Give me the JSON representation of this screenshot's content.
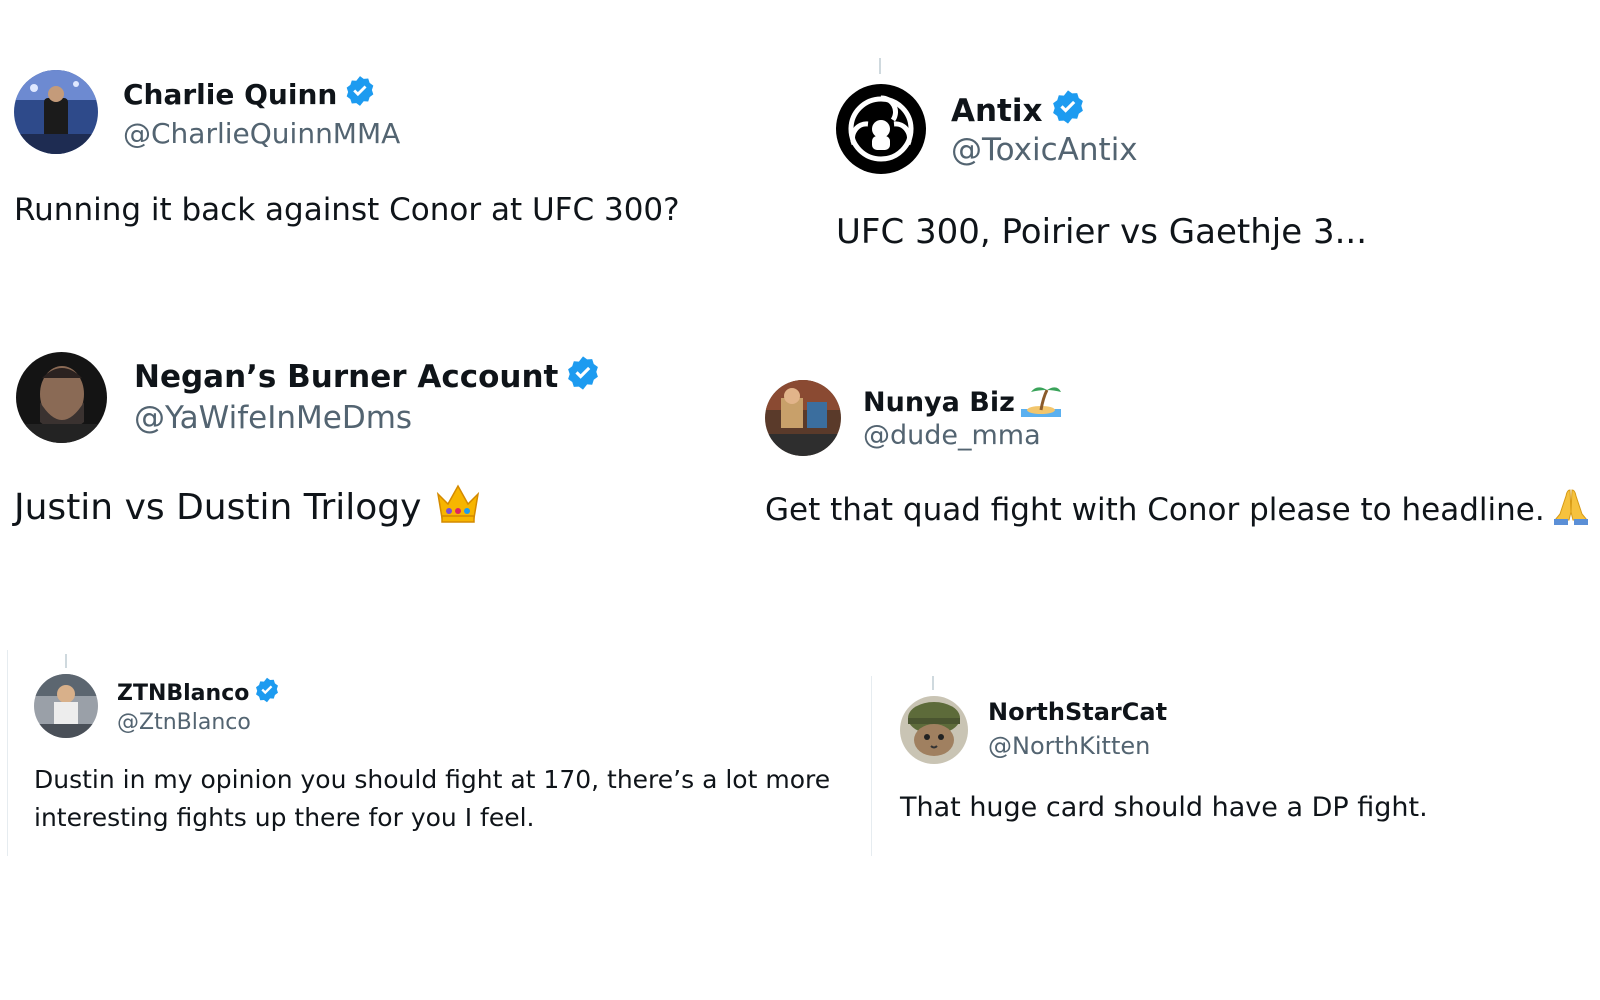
{
  "tweets": [
    {
      "name": "Charlie Quinn",
      "handle": "@CharlieQuinnMMA",
      "text": "Running it back against Conor at UFC 300?",
      "verified": true,
      "avatar_icon": "arena-photo-avatar"
    },
    {
      "name": "Antix",
      "handle": "@ToxicAntix",
      "text": "UFC 300, Poirier vs Gaethje 3...",
      "verified": true,
      "avatar_icon": "gas-mask-biohazard-avatar"
    },
    {
      "name": "Negan’s Burner Account",
      "handle": "@YaWifeInMeDms",
      "text": "Justin vs Dustin Trilogy",
      "verified": true,
      "emoji": "crown",
      "avatar_icon": "bearded-man-avatar"
    },
    {
      "name": "Nunya Biz",
      "handle": "@dude_mma",
      "text": "Get that quad fight with Conor please to headline.",
      "verified": false,
      "name_emoji": "desert-island",
      "emoji": "folded-hands",
      "avatar_icon": "cartoon-avatar"
    },
    {
      "name": "ZTNBlanco",
      "handle": "@ZtnBlanco",
      "text_lines": [
        "Dustin in my opinion you should fight at 170, there’s a lot more",
        "interesting fights up there for you I feel."
      ],
      "verified": true,
      "avatar_icon": "fighter-photo-avatar"
    },
    {
      "name": "NorthStarCat",
      "handle": "@NorthKitten",
      "text": "That huge card should have a DP fight.",
      "verified": false,
      "avatar_icon": "cat-helmet-avatar"
    }
  ],
  "colors": {
    "verified_blue": "#1d9bf0",
    "handle_gray": "#536471",
    "text": "#0f1419"
  }
}
